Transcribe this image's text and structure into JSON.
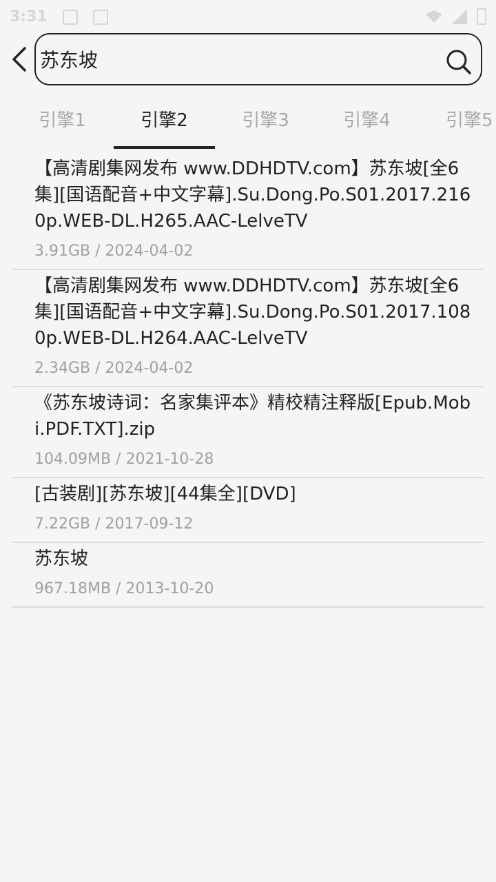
{
  "status": {
    "time": "3:31"
  },
  "search": {
    "value": "苏东坡"
  },
  "tabs": [
    {
      "label": "引擎1"
    },
    {
      "label": "引擎2"
    },
    {
      "label": "引擎3"
    },
    {
      "label": "引擎4"
    },
    {
      "label": "引擎5"
    }
  ],
  "active_tab": "引擎2",
  "results": [
    {
      "title": "【高清剧集网发布 www.DDHDTV.com】苏东坡[全6集][国语配音+中文字幕].Su.Dong.Po.S01.2017.2160p.WEB-DL.H265.AAC-LelveTV",
      "size": "3.91GB",
      "date": "2024-04-02"
    },
    {
      "title": "【高清剧集网发布 www.DDHDTV.com】苏东坡[全6集][国语配音+中文字幕].Su.Dong.Po.S01.2017.1080p.WEB-DL.H264.AAC-LelveTV",
      "size": "2.34GB",
      "date": "2024-04-02"
    },
    {
      "title": "《苏东坡诗词：名家集评本》精校精注释版[Epub.Mobi.PDF.TXT].zip",
      "size": "104.09MB",
      "date": "2021-10-28"
    },
    {
      "title": "[古装剧][苏东坡][44集全][DVD]",
      "size": "7.22GB",
      "date": "2017-09-12"
    },
    {
      "title": "苏东坡",
      "size": "967.18MB",
      "date": "2013-10-20"
    }
  ],
  "colors": {
    "text": "#222222",
    "muted": "#a0a0a0",
    "divider": "#dcdcdc",
    "background": "#f5f5f5"
  },
  "icons": {
    "back": "chevron-left-icon",
    "search": "search-icon"
  }
}
